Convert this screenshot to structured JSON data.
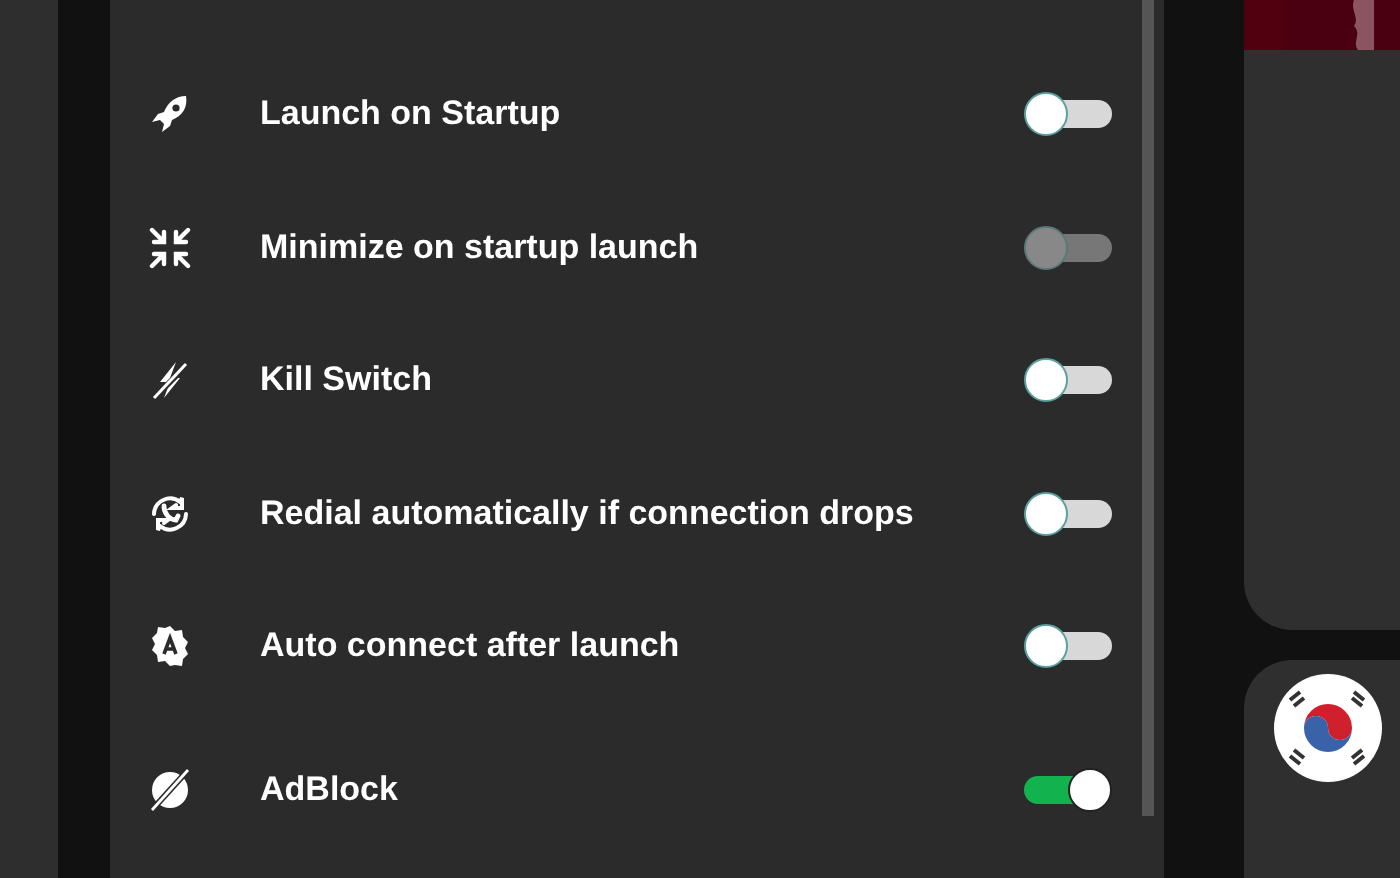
{
  "settings": [
    {
      "label": "Launch on Startup",
      "on": false,
      "disabled": false
    },
    {
      "label": "Minimize on startup launch",
      "on": false,
      "disabled": true
    },
    {
      "label": "Kill Switch",
      "on": false,
      "disabled": false
    },
    {
      "label": "Redial automatically if connection drops",
      "on": false,
      "disabled": false
    },
    {
      "label": "Auto connect after launch",
      "on": false,
      "disabled": false
    },
    {
      "label": "AdBlock",
      "on": true,
      "disabled": false
    }
  ]
}
